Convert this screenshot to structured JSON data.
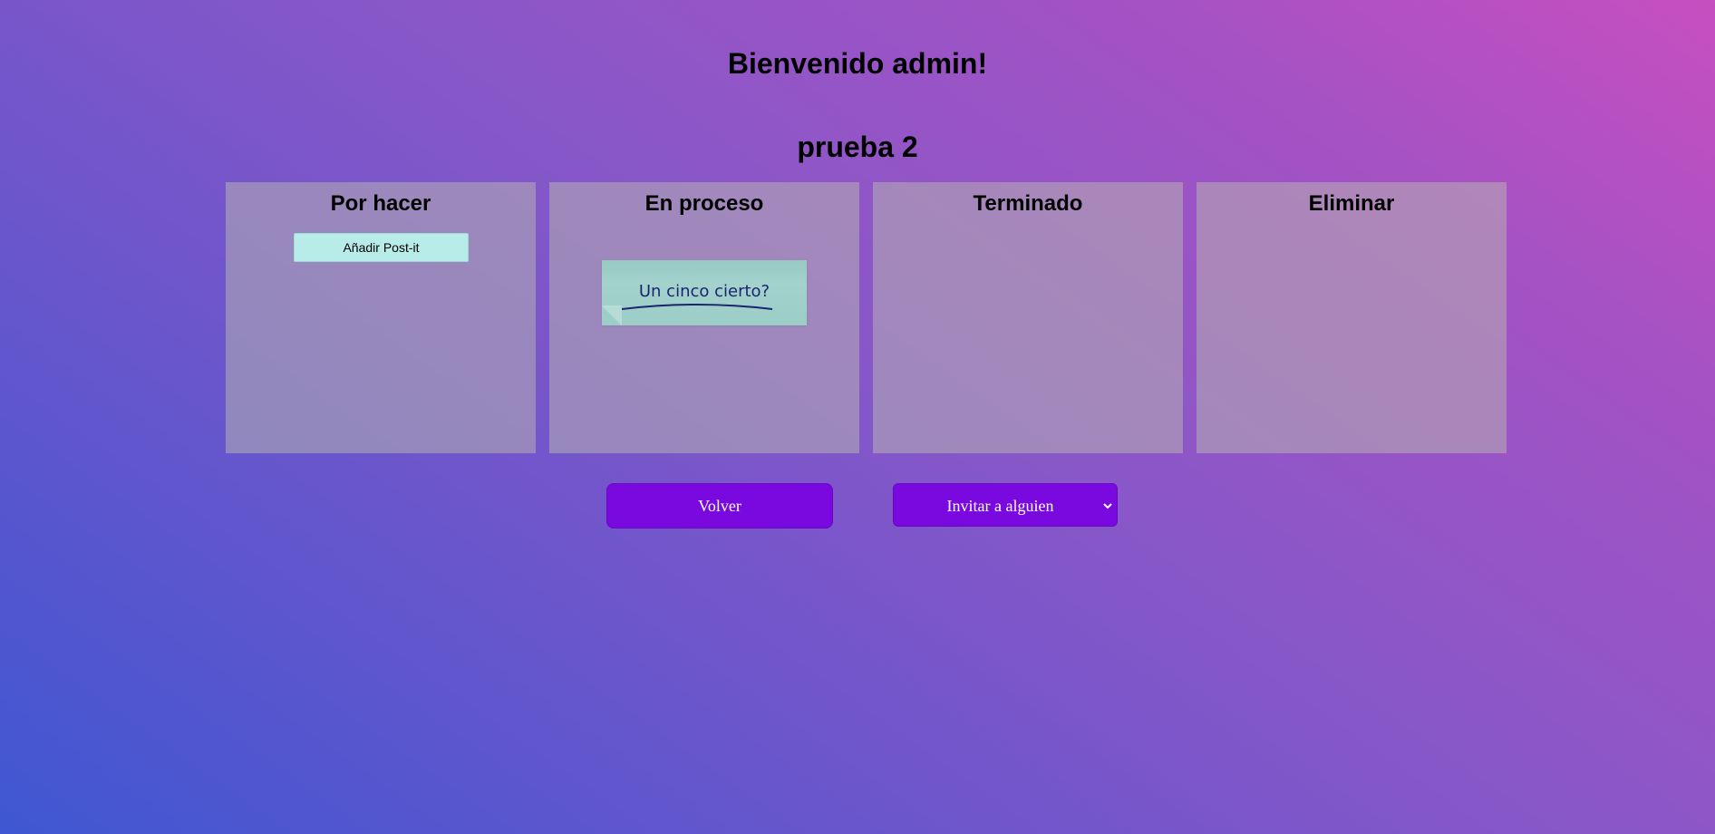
{
  "header": {
    "welcome": "Bienvenido admin!",
    "board_title": "prueba 2"
  },
  "columns": [
    {
      "title": "Por hacer"
    },
    {
      "title": "En proceso"
    },
    {
      "title": "Terminado"
    },
    {
      "title": "Eliminar"
    }
  ],
  "todo": {
    "add_button_label": "Añadir Post-it"
  },
  "postits": [
    {
      "text": "Un cinco cierto?",
      "column": "En proceso",
      "color": "#9ccdc6"
    }
  ],
  "actions": {
    "back_label": "Volver",
    "invite_label": "Invitar a alguien"
  },
  "colors": {
    "button_bg": "#7a09e0",
    "postit_text": "#1a2470",
    "add_button_bg": "#b8ece8"
  },
  "icons": {
    "invite_dropdown": "chevron-down-icon"
  }
}
